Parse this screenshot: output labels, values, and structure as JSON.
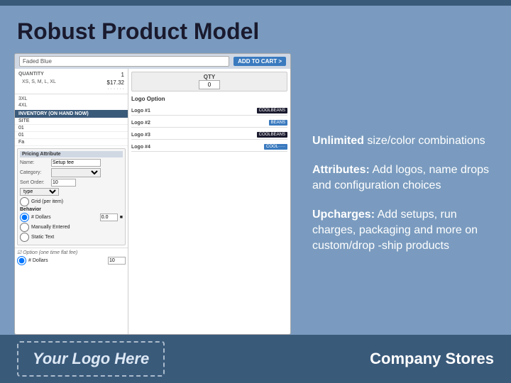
{
  "slide": {
    "title": "Robust Product Model",
    "top_bar_color": "#3a5a7a",
    "background_color": "#7a9bbf"
  },
  "screenshot": {
    "product_name": "Faded Blue",
    "add_to_cart_btn": "ADD TO CART >",
    "quantity_label": "QUANTITY",
    "quantity_value": "1",
    "sizes_label": "XS, S, M, L, XL",
    "price": "$17.32",
    "price_dots": "· · · · · ·",
    "size_rows": [
      {
        "size": "3XL",
        "label": ""
      },
      {
        "size": "4XL",
        "label": ""
      }
    ],
    "qty_title": "QTY",
    "qty_value": "0",
    "inventory_header": "INVENTORY (ON HAND NOW)",
    "inventory_rows": [
      {
        "site": "SITE",
        "qty": ""
      },
      {
        "site": "01",
        "qty": ""
      },
      {
        "site": "01",
        "qty": ""
      },
      {
        "site": "Fa",
        "qty": ""
      }
    ],
    "pricing_header": "Pricing Attribute",
    "pricing_fields": [
      {
        "label": "Name:",
        "value": "Setup fee"
      },
      {
        "label": "Category:",
        "value": ""
      },
      {
        "label": "Sort Order:",
        "value": "10"
      }
    ],
    "type_label": "type",
    "grid_label": "Grid (per item)",
    "behavior_label": "Behavior",
    "radio_options": [
      {
        "id": "r1",
        "label": "# Dollars",
        "value": "0.0"
      },
      {
        "id": "r2",
        "label": "Manually Entered"
      },
      {
        "id": "r3",
        "label": "Static Text"
      }
    ],
    "option_label": "Option (one time flatfee)",
    "option_radio": "# Dollars",
    "option_value": "10",
    "logo_option_label": "Logo Option",
    "logos": [
      {
        "label": "Logo #1",
        "badge": "COOLBEANS",
        "badge_class": "dark"
      },
      {
        "label": "Logo #2",
        "badge": "BEANS",
        "badge_class": "blue"
      },
      {
        "label": "Logo #3",
        "badge": "COOLBEANS",
        "badge_class": "dark"
      },
      {
        "label": "Logo #4",
        "badge": "COOL·····",
        "badge_class": "blue"
      }
    ]
  },
  "bullets": [
    {
      "strong": "Unlimited",
      "text": " size/color combinations"
    },
    {
      "strong": "Attributes:",
      "text": " Add logos, name drops and configuration choices"
    },
    {
      "strong": "Upcharges:",
      "text": " Add setups, run charges, packaging and more on custom/drop -ship products"
    }
  ],
  "bottom": {
    "logo_text": "Your Logo Here",
    "company_text": "Company Stores"
  }
}
